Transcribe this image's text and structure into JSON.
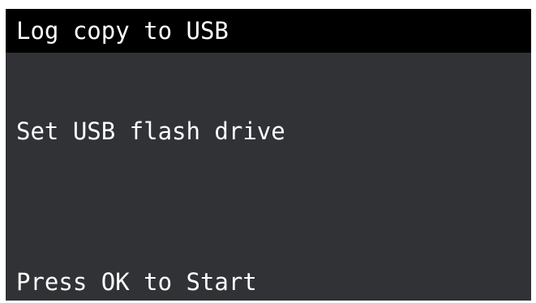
{
  "screen": {
    "title": "Log copy to USB",
    "message": "Set USB flash drive",
    "prompt": "Press OK to Start"
  },
  "colors": {
    "title_bar_background": "#000000",
    "screen_background": "#303236",
    "text": "#ffffff"
  }
}
